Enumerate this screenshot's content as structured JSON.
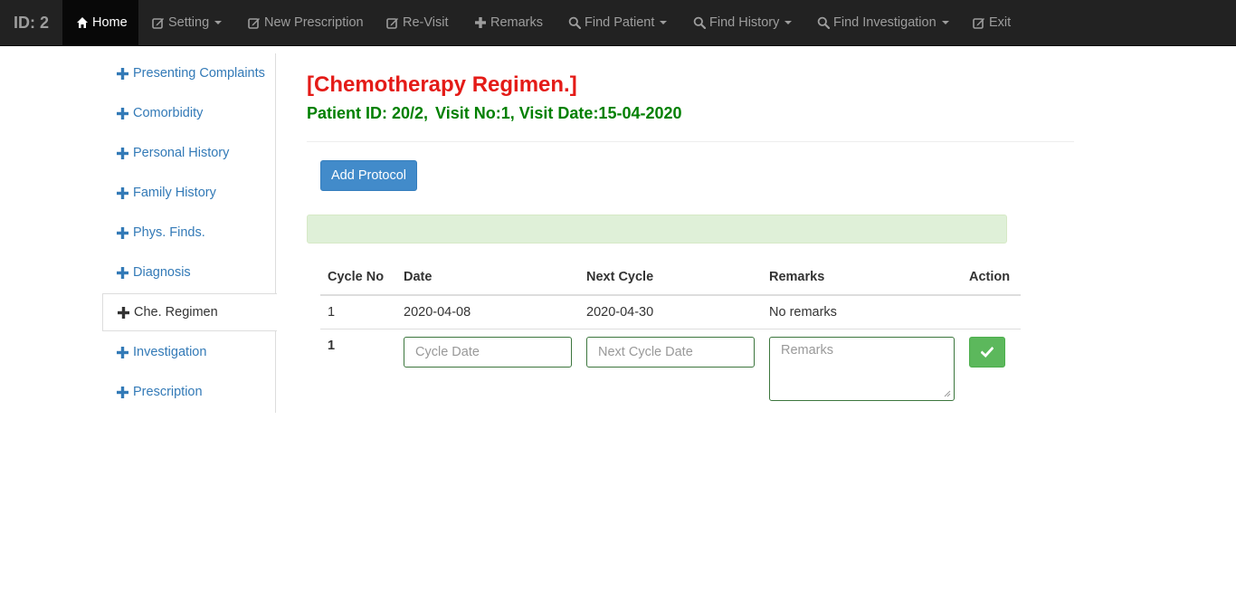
{
  "navbar": {
    "brand": "ID: 2",
    "items": [
      {
        "label": "Home",
        "icon": "home-icon",
        "active": true
      },
      {
        "label": "Setting",
        "icon": "edit-icon",
        "dropdown": true
      },
      {
        "label": "New Prescription",
        "icon": "edit-icon"
      },
      {
        "label": "Re-Visit",
        "icon": "edit-icon"
      },
      {
        "label": "Remarks",
        "icon": "plus-icon"
      },
      {
        "label": "Find Patient",
        "icon": "search-icon",
        "dropdown": true
      },
      {
        "label": "Find History",
        "icon": "search-icon",
        "dropdown": true
      },
      {
        "label": "Find Investigation",
        "icon": "search-icon",
        "dropdown": true
      },
      {
        "label": "Exit",
        "icon": "edit-icon"
      }
    ]
  },
  "sidebar": {
    "items": [
      {
        "label": "Presenting Complaints"
      },
      {
        "label": "Comorbidity"
      },
      {
        "label": "Personal History"
      },
      {
        "label": "Family History"
      },
      {
        "label": "Phys. Finds."
      },
      {
        "label": "Diagnosis"
      },
      {
        "label": "Che. Regimen",
        "active": true
      },
      {
        "label": "Investigation"
      },
      {
        "label": "Prescription"
      }
    ]
  },
  "main": {
    "title": "[Chemotherapy Regimen.]",
    "patient_id": "Patient ID: 20/2,",
    "visit_info": "Visit No:1, Visit Date:15-04-2020",
    "add_button": "Add Protocol"
  },
  "table": {
    "headers": [
      "Cycle No",
      "Date",
      "Next Cycle",
      "Remarks",
      "Action"
    ],
    "rows": [
      {
        "cycle_no": "1",
        "date": "2020-04-08",
        "next_cycle": "2020-04-30",
        "remarks": "No remarks"
      }
    ],
    "new_row": {
      "cycle_no": "1",
      "date_placeholder": "Cycle Date",
      "next_placeholder": "Next Cycle Date",
      "remarks_placeholder": "Remarks",
      "save_icon": "check-icon"
    }
  },
  "colors": {
    "navbar_bg": "#222222",
    "link": "#337ab7",
    "title_red": "#e41b17",
    "subtitle_green": "#008000",
    "primary_button": "#428bca",
    "success_button": "#5cb85c",
    "alert_bg": "#dff0d8"
  }
}
